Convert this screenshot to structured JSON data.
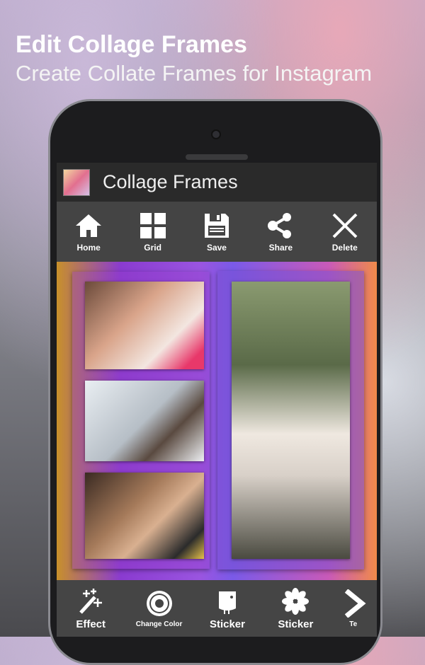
{
  "promo": {
    "title": "Edit Collage Frames",
    "subtitle": "Create Collate Frames for Instagram"
  },
  "app": {
    "title": "Collage Frames"
  },
  "top_toolbar": [
    {
      "label": "Home",
      "icon": "home-icon"
    },
    {
      "label": "Grid",
      "icon": "grid-icon"
    },
    {
      "label": "Save",
      "icon": "floppy-disk-icon"
    },
    {
      "label": "Share",
      "icon": "share-icon"
    },
    {
      "label": "Delete",
      "icon": "close-icon"
    }
  ],
  "bottom_toolbar": [
    {
      "label": "Effect",
      "icon": "magic-wand-icon"
    },
    {
      "label": "Change Color",
      "icon": "aperture-icon"
    },
    {
      "label": "Sticker",
      "icon": "bird-icon"
    },
    {
      "label": "Sticker",
      "icon": "flower-icon"
    },
    {
      "label": "Te",
      "icon": "chevron-right-icon"
    }
  ]
}
